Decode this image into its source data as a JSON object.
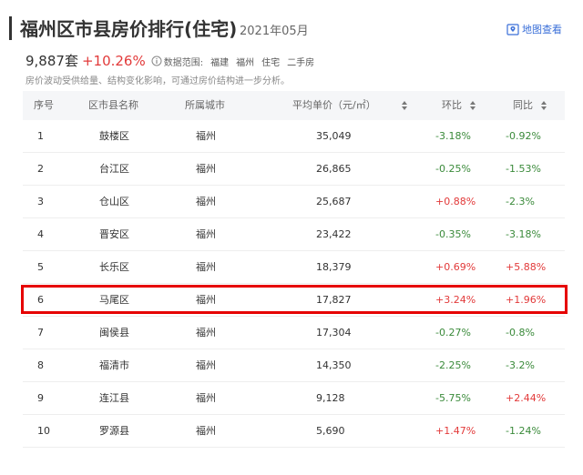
{
  "header": {
    "title": "福州区市县房价排行(住宅)",
    "date": "2021年05月",
    "map_link_label": "地图查看"
  },
  "summary": {
    "price_count": "9,887套",
    "price_change": "+10.26%",
    "scope_label": "数据范围:",
    "scope_tags": [
      "福建",
      "福州",
      "住宅",
      "二手房"
    ],
    "note": "房价波动受供给量、结构变化影响，可通过房价结构进一步分析。"
  },
  "table": {
    "columns": [
      "序号",
      "区市县名称",
      "所属城市",
      "平均单价（元/㎡）",
      "环比",
      "同比"
    ],
    "rows": [
      {
        "rank": "1",
        "district": "鼓楼区",
        "city": "福州",
        "price": "35,049",
        "mom": "-3.18%",
        "mom_dir": "down",
        "yoy": "-0.92%",
        "yoy_dir": "down"
      },
      {
        "rank": "2",
        "district": "台江区",
        "city": "福州",
        "price": "26,865",
        "mom": "-0.25%",
        "mom_dir": "down",
        "yoy": "-1.53%",
        "yoy_dir": "down"
      },
      {
        "rank": "3",
        "district": "仓山区",
        "city": "福州",
        "price": "25,687",
        "mom": "+0.88%",
        "mom_dir": "up",
        "yoy": "-2.3%",
        "yoy_dir": "down"
      },
      {
        "rank": "4",
        "district": "晋安区",
        "city": "福州",
        "price": "23,422",
        "mom": "-0.35%",
        "mom_dir": "down",
        "yoy": "-3.18%",
        "yoy_dir": "down"
      },
      {
        "rank": "5",
        "district": "长乐区",
        "city": "福州",
        "price": "18,379",
        "mom": "+0.69%",
        "mom_dir": "up",
        "yoy": "+5.88%",
        "yoy_dir": "up"
      },
      {
        "rank": "6",
        "district": "马尾区",
        "city": "福州",
        "price": "17,827",
        "mom": "+3.24%",
        "mom_dir": "up",
        "yoy": "+1.96%",
        "yoy_dir": "up"
      },
      {
        "rank": "7",
        "district": "闽侯县",
        "city": "福州",
        "price": "17,304",
        "mom": "-0.27%",
        "mom_dir": "down",
        "yoy": "-0.8%",
        "yoy_dir": "down"
      },
      {
        "rank": "8",
        "district": "福清市",
        "city": "福州",
        "price": "14,350",
        "mom": "-2.25%",
        "mom_dir": "down",
        "yoy": "-3.2%",
        "yoy_dir": "down"
      },
      {
        "rank": "9",
        "district": "连江县",
        "city": "福州",
        "price": "9,128",
        "mom": "-5.75%",
        "mom_dir": "down",
        "yoy": "+2.44%",
        "yoy_dir": "up"
      },
      {
        "rank": "10",
        "district": "罗源县",
        "city": "福州",
        "price": "5,690",
        "mom": "+1.47%",
        "mom_dir": "up",
        "yoy": "-1.24%",
        "yoy_dir": "down"
      }
    ]
  },
  "colors": {
    "up": "#e23a3a",
    "down": "#3a8a3a",
    "highlight": "#e60000",
    "link": "#3a6fd8"
  }
}
